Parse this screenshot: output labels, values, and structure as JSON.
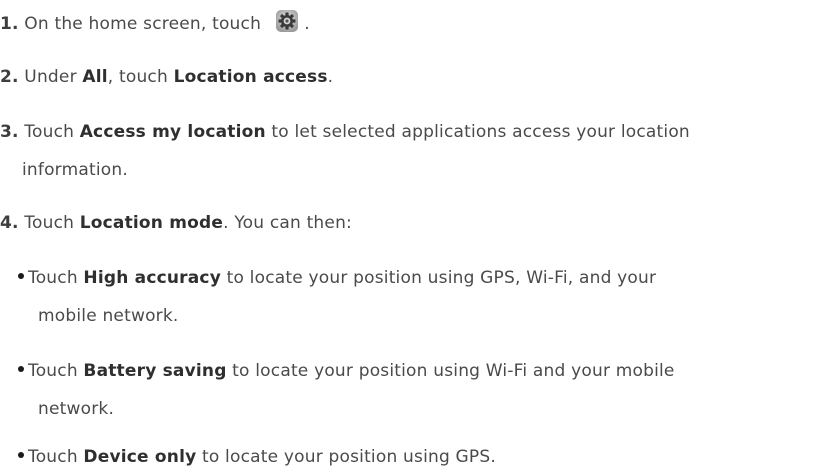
{
  "steps": [
    {
      "number": "1.",
      "pre": "On the home screen, touch",
      "icon": "settings-gear-icon",
      "post": "."
    },
    {
      "number": "2.",
      "pre": "Under ",
      "bold1": "All",
      "mid": ", touch ",
      "bold2": "Location access",
      "post": "."
    },
    {
      "number": "3.",
      "pre": "Touch ",
      "bold": "Access my location",
      "post": " to let selected applications access your location",
      "cont": "information."
    },
    {
      "number": "4.",
      "pre": "Touch ",
      "bold": "Location mode",
      "post": ". You can then:"
    }
  ],
  "bullets": [
    {
      "pre": "Touch ",
      "bold": "High accuracy",
      "post": " to locate your position using GPS, Wi-Fi, and your",
      "cont": "mobile network."
    },
    {
      "pre": "Touch ",
      "bold": "Battery saving",
      "post": " to locate your position using Wi-Fi and your mobile",
      "cont": "network."
    },
    {
      "pre": "Touch ",
      "bold": "Device only",
      "post": " to locate your position using GPS."
    }
  ],
  "colors": {
    "text": "#4a4a4a",
    "bold": "#2f2f2f",
    "bullet": "#1a1a1a"
  }
}
